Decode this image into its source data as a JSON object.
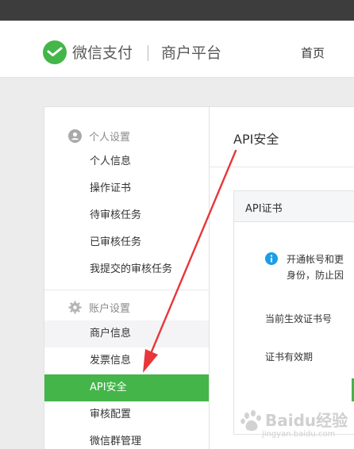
{
  "header": {
    "brand": "微信支付",
    "sub_brand": "商户平台",
    "nav": {
      "home": "首页"
    }
  },
  "sidebar": {
    "groups": [
      {
        "title": "个人设置",
        "icon": "user-icon",
        "items": [
          {
            "label": "个人信息"
          },
          {
            "label": "操作证书"
          },
          {
            "label": "待审核任务"
          },
          {
            "label": "已审核任务"
          },
          {
            "label": "我提交的审核任务"
          }
        ]
      },
      {
        "title": "账户设置",
        "icon": "gear-icon",
        "items": [
          {
            "label": "商户信息"
          },
          {
            "label": "发票信息"
          },
          {
            "label": "API安全"
          },
          {
            "label": "审核配置"
          },
          {
            "label": "微信群管理"
          }
        ]
      }
    ],
    "active_item": "API安全"
  },
  "main": {
    "title": "API安全",
    "card": {
      "title": "API证书",
      "notice_lines": [
        "开通帐号和更",
        "身份，防止因"
      ],
      "fields": [
        {
          "label": "当前生效证书号"
        },
        {
          "label": "证书有效期"
        }
      ]
    }
  },
  "watermark": {
    "text": "Baidu经验",
    "sub": "jingyan.baidu.com"
  },
  "colors": {
    "accent": "#44b549",
    "topbar": "#3d3d3d",
    "info": "#1a9ee8",
    "annotation_arrow": "#e8363a"
  }
}
